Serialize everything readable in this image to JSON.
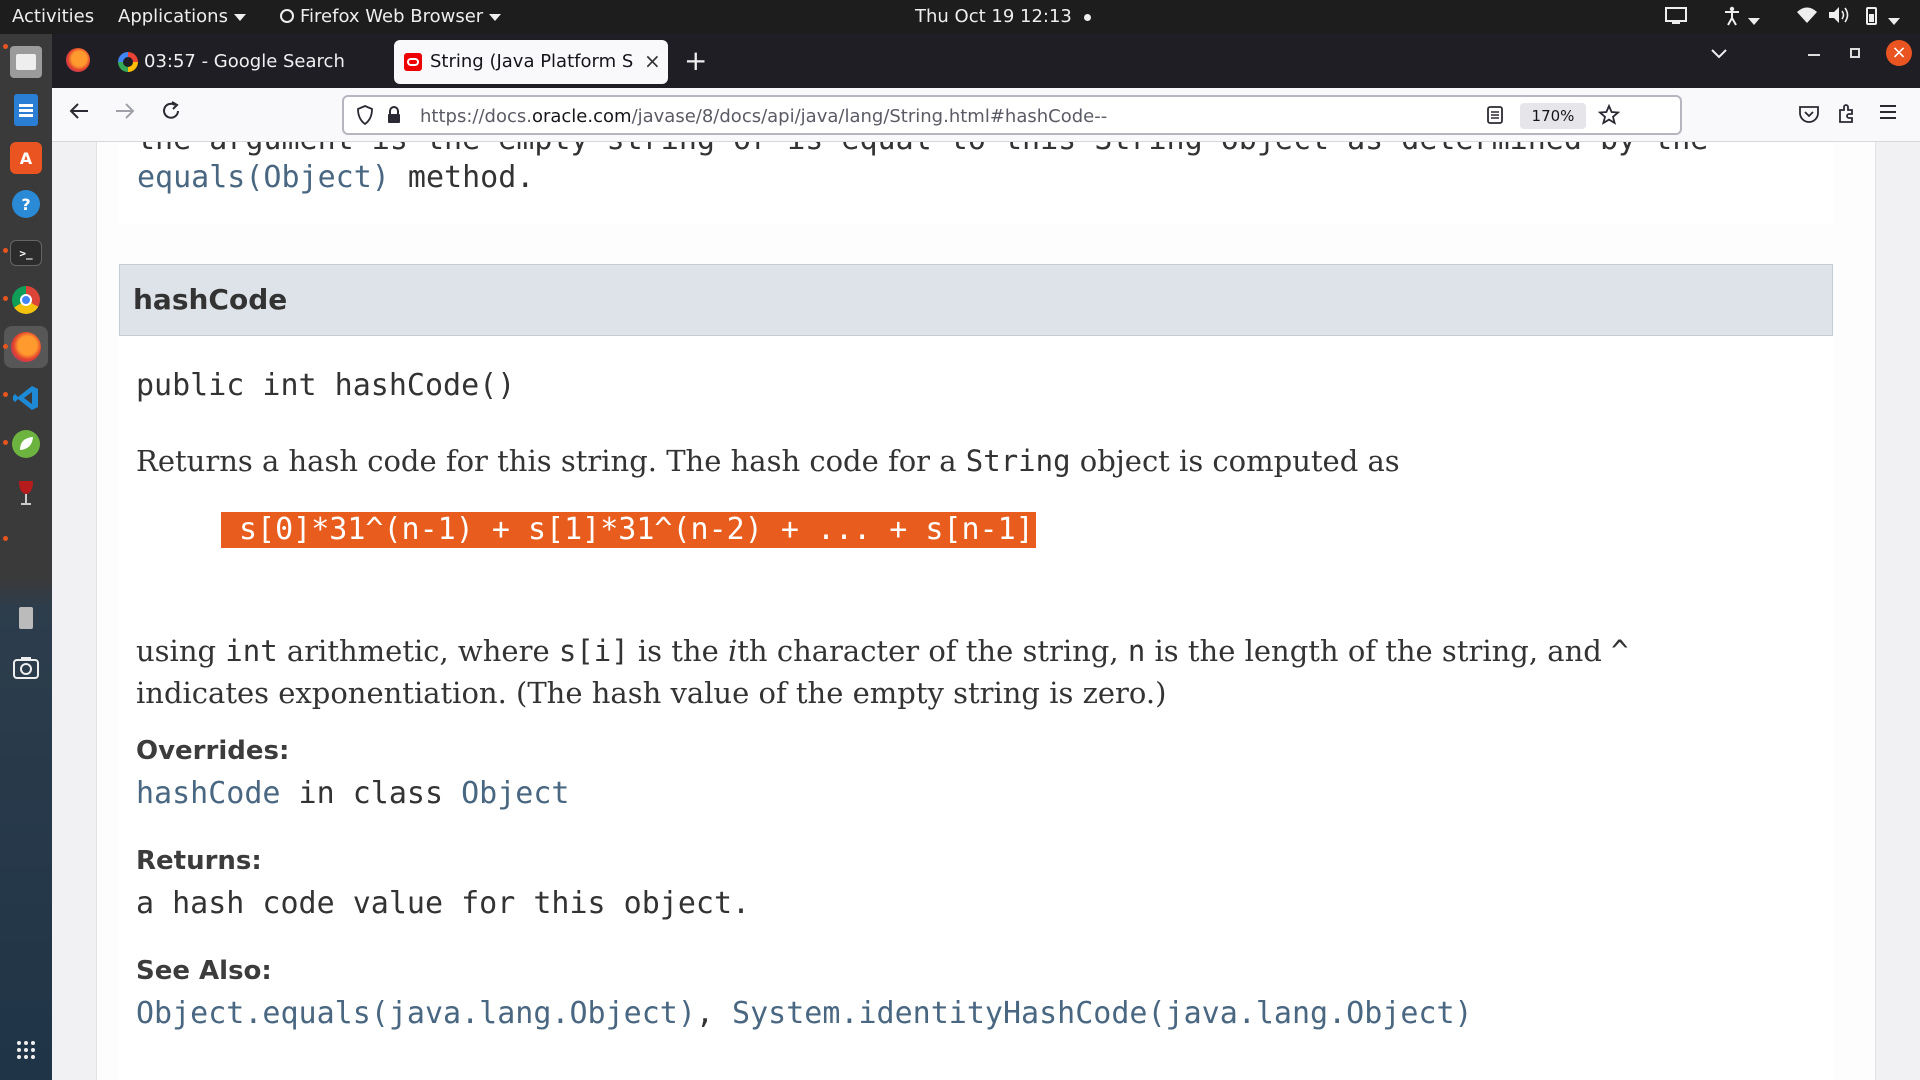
{
  "system_bar": {
    "activities": "Activities",
    "applications": "Applications",
    "app_name": "Firefox Web Browser",
    "clock": "Thu Oct 19  12:13"
  },
  "browser": {
    "tabs": [
      {
        "title": "03:57 - Google Search",
        "active": false
      },
      {
        "title": "String (Java Platform SE",
        "active": true
      }
    ],
    "new_tab": "+",
    "url_prefix": "https://docs.",
    "url_domain": "oracle.com",
    "url_path": "/javase/8/docs/api/java/lang/String.html#hashCode--",
    "zoom": "170%"
  },
  "content": {
    "prev_line1": "the argument is the empty string or is equal to this String object as determined by the",
    "prev_link": "equals(Object)",
    "prev_method": " method.",
    "section_title": "hashCode",
    "signature": "public int hashCode()",
    "desc1_a": "Returns a hash code for this string. The hash code for a ",
    "desc1_code": "String",
    "desc1_b": " object is computed as",
    "formula": "s[0]*31^(n-1) + s[1]*31^(n-2) + ... + s[n-1]",
    "desc2_a": "using ",
    "desc2_int": "int",
    "desc2_b": " arithmetic, where ",
    "desc2_si": "s[i]",
    "desc2_c": " is the ",
    "desc2_i": "i",
    "desc2_d": "th character of the string, ",
    "desc2_n": "n",
    "desc2_e": " is the length of the string, and ",
    "desc2_caret": "^",
    "desc2_line2": "indicates exponentiation. (The hash value of the empty string is zero.)",
    "overrides_label": "Overrides:",
    "overrides_link": "hashCode",
    "overrides_mid": " in class ",
    "overrides_class": "Object",
    "returns_label": "Returns:",
    "returns_text": "a hash code value for this object.",
    "see_also_label": "See Also:",
    "see_also_1": "Object.equals(java.lang.Object)",
    "see_also_sep": ", ",
    "see_also_2": "System.identityHashCode(java.lang.Object)"
  },
  "icons": [
    "files-icon",
    "writer-icon",
    "software-icon",
    "help-icon",
    "terminal-icon",
    "chrome-icon",
    "firefox-icon",
    "vscode-icon",
    "spring-icon",
    "wine-icon",
    "usb-icon",
    "screenshot-icon",
    "app-grid-icon"
  ],
  "colors": {
    "accent": "#e95420",
    "formula_bg": "#e85d1e",
    "link": "#4a6782",
    "header_bg": "#dee3e9"
  }
}
